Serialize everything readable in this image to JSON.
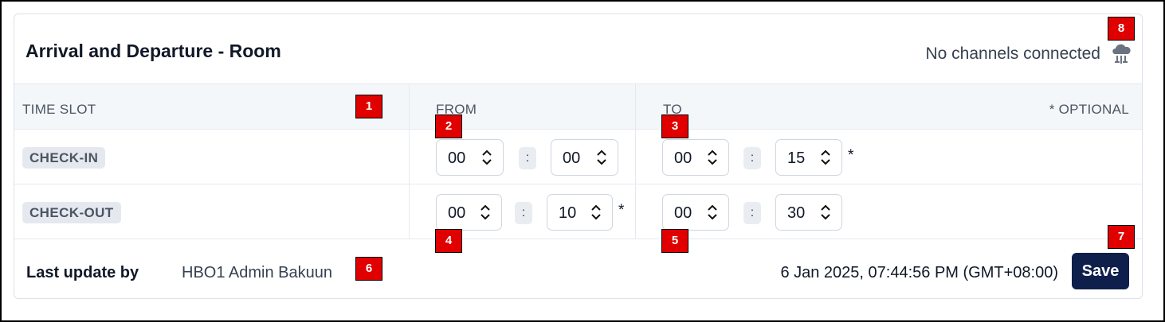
{
  "header": {
    "title": "Arrival and Departure - Room",
    "channels_status": "No channels connected",
    "channel_icon": "cloud-sync-icon"
  },
  "table": {
    "headers": {
      "time_slot": "TIME SLOT",
      "from": "FROM",
      "to": "TO",
      "optional_note": "* OPTIONAL"
    },
    "separator": ":",
    "optional_mark": "*",
    "rows": [
      {
        "label": "CHECK-IN",
        "from_hour": "00",
        "from_minute": "00",
        "to_hour": "00",
        "to_minute": "15"
      },
      {
        "label": "CHECK-OUT",
        "from_hour": "00",
        "from_minute": "10",
        "to_hour": "00",
        "to_minute": "30"
      }
    ]
  },
  "footer": {
    "last_update_label": "Last update by",
    "last_update_user": "HBO1 Admin Bakuun",
    "last_update_time": "6 Jan 2025, 07:44:56 PM (GMT+08:00)",
    "save_label": "Save"
  },
  "markers": [
    "1",
    "2",
    "3",
    "4",
    "5",
    "6",
    "7",
    "8"
  ],
  "colors": {
    "save_button": "#0f1f4b",
    "marker": "#e00000",
    "header_bg": "#f4f7fa",
    "chip_bg": "#e5e9ef"
  }
}
